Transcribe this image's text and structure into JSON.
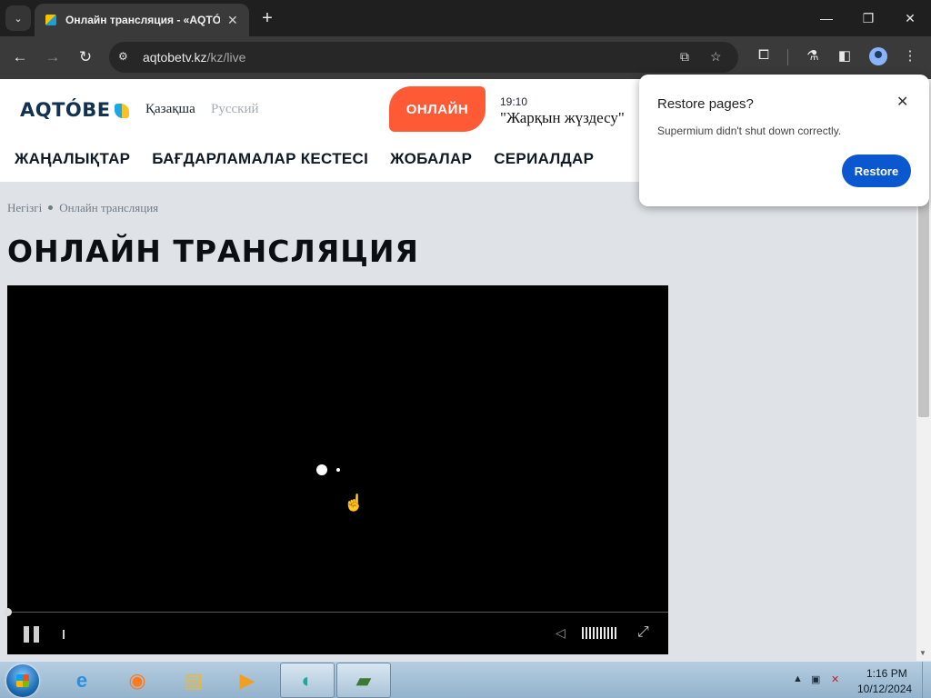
{
  "browser": {
    "tab_title": "Онлайн трансляция - «AQTÓBE",
    "tab_close": "✕",
    "new_tab": "+",
    "url_host": "aqtobetv.kz",
    "url_path": "/kz/live",
    "window_controls": {
      "minimize": "—",
      "restore": "❐",
      "close": "✕"
    }
  },
  "site": {
    "logo_text": "AQTÓBE",
    "languages": [
      "Қазақша",
      "Русский"
    ],
    "live_button": "ОНЛАЙН",
    "now_playing": {
      "time": "19:10",
      "title": "\"Жарқын жүздесу\""
    },
    "nav": [
      "ЖАҢАЛЫҚТАР",
      "БАҒДАРЛАМАЛАР КЕСТЕСІ",
      "ЖОБАЛАР",
      "СЕРИАЛДАР"
    ],
    "breadcrumb": [
      "Негізгі",
      "Онлайн трансляция"
    ],
    "page_title": "ОНЛАЙН ТРАНСЛЯЦИЯ"
  },
  "player": {
    "state": "loading",
    "playing": true,
    "volume_muted": false
  },
  "popup": {
    "title": "Restore pages?",
    "message": "Supermium didn't shut down correctly.",
    "restore_button": "Restore",
    "close": "✕"
  },
  "taskbar": {
    "clock_time": "1:16 PM",
    "clock_date": "10/12/2024",
    "apps": [
      "internet-explorer",
      "firefox",
      "file-explorer",
      "media-player",
      "supermium",
      "notepad"
    ]
  },
  "colors": {
    "accent_live": "#ff5a36",
    "restore_button": "#0b57d0",
    "page_background": "#dfe3e7"
  }
}
